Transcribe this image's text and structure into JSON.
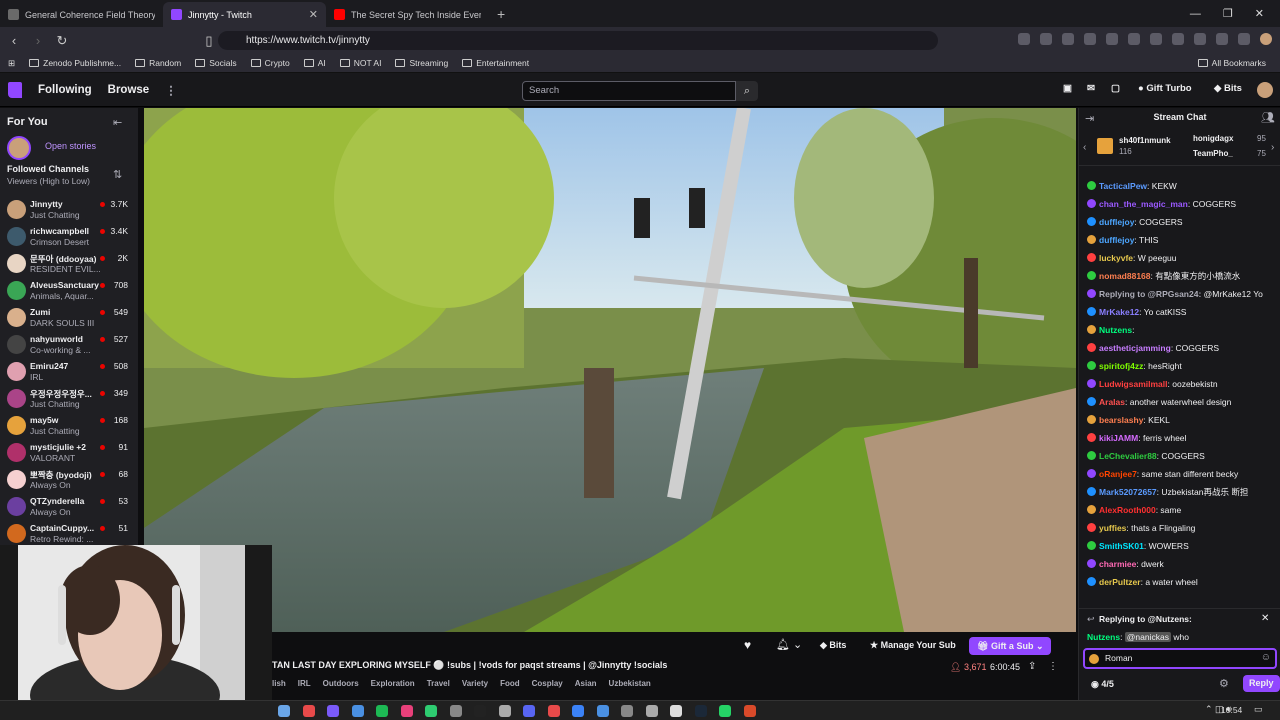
{
  "browser": {
    "tabs": [
      {
        "title": "General Coherence Field Theory (GC",
        "active": false,
        "color": "#6a6a6a"
      },
      {
        "title": "Jinnytty - Twitch",
        "active": true,
        "color": "#9147ff"
      },
      {
        "title": "The Secret Spy Tech Inside Every Cre",
        "active": false,
        "color": "#ff0000"
      }
    ],
    "url": "https://www.twitch.tv/jinnytty",
    "bookmarks": [
      "Zenodo Publishme...",
      "Random",
      "Socials",
      "Crypto",
      "AI",
      "NOT AI",
      "Streaming",
      "Entertainment"
    ],
    "all_bookmarks": "All Bookmarks"
  },
  "twitch_nav": {
    "following": "Following",
    "browse": "Browse",
    "search_placeholder": "Search",
    "gift_turbo": "Gift Turbo",
    "bits": "Bits"
  },
  "sidebar": {
    "for_you": "For You",
    "open_stories": "Open stories",
    "followed_title": "Followed Channels",
    "followed_sort": "Viewers (High to Low)",
    "channels": [
      {
        "name": "Jinnytty",
        "game": "Just Chatting",
        "viewers": "3.7K",
        "color": "#c9a07a"
      },
      {
        "name": "richwcampbell",
        "game": "Crimson Desert",
        "viewers": "3.4K",
        "color": "#3d5a6c"
      },
      {
        "name": "문뚜아 (ddooyaa)",
        "game": "RESIDENT EVIL...",
        "viewers": "2K",
        "color": "#e8d5c4"
      },
      {
        "name": "AlveusSanctuary",
        "game": "Animals, Aquar...",
        "viewers": "708",
        "color": "#3aa655"
      },
      {
        "name": "Zumi",
        "game": "DARK SOULS III",
        "viewers": "549",
        "color": "#d9b08c"
      },
      {
        "name": "nahyunworld",
        "game": "Co-working & ...",
        "viewers": "527",
        "color": "#444"
      },
      {
        "name": "Emiru247",
        "game": "IRL",
        "viewers": "508",
        "color": "#e0a0b0"
      },
      {
        "name": "우정우정우정우...",
        "game": "Just Chatting",
        "viewers": "349",
        "color": "#a48",
        "}": null
      },
      {
        "name": "may5w",
        "game": "Just Chatting",
        "viewers": "168",
        "color": "#e6a23c"
      },
      {
        "name": "mysticjulie +2",
        "game": "VALORANT",
        "viewers": "91",
        "color": "#b0306a"
      },
      {
        "name": "뽀짝충 (byodoji)",
        "game": "Always On",
        "viewers": "68",
        "color": "#f5d0d0"
      },
      {
        "name": "QTZynderella",
        "game": "Always On",
        "viewers": "53",
        "color": "#6b3fa0"
      },
      {
        "name": "CaptainCuppy...",
        "game": "Retro Rewind: ...",
        "viewers": "51",
        "color": "#d2691e"
      }
    ]
  },
  "stream": {
    "title": "TAN LAST DAY EXPLORING MYSELF ⚪ !subs | !vods for paqst streams | @Jinnytty !socials",
    "tags": [
      "lish",
      "IRL",
      "Outdoors",
      "Exploration",
      "Travel",
      "Variety",
      "Food",
      "Cosplay",
      "Asian",
      "Uzbekistan"
    ],
    "viewers": "3,671",
    "uptime": "6:00:45",
    "bits_label": "Bits",
    "manage_sub": "Manage Your Sub",
    "gift_sub": "Gift a Sub"
  },
  "chat": {
    "title": "Stream Chat",
    "top_gifters": [
      {
        "name": "sh40f1nmunk",
        "count": "116"
      },
      {
        "name": "honigdagx",
        "count": "95"
      },
      {
        "name": "TeamPho_",
        "count": "75"
      }
    ],
    "messages": [
      {
        "user": "TacticalPew",
        "color": "#5b9bff",
        "text": "KEKW"
      },
      {
        "user": "chan_the_magic_man",
        "color": "#9b59ff",
        "text": "COGGERS"
      },
      {
        "user": "dufflejoy",
        "color": "#4da6ff",
        "text": "COGGERS"
      },
      {
        "user": "dufflejoy",
        "color": "#4da6ff",
        "text": "THIS"
      },
      {
        "user": "luckyvfe",
        "color": "#e6c84d",
        "text": "W peeguu"
      },
      {
        "user": "nomad88168",
        "color": "#ff7f50",
        "text": "有點像東方的小橋流水"
      },
      {
        "user": "Replying to @RPGsan24:",
        "color": "#adadb8",
        "text": "@MrKake12 Yo"
      },
      {
        "user": "MrKake12",
        "color": "#8a7fff",
        "text": "Yo catKISS"
      },
      {
        "user": "Nutzens",
        "color": "#00ff7f",
        "text": ""
      },
      {
        "user": "aestheticjamming",
        "color": "#c77dff",
        "text": "COGGERS"
      },
      {
        "user": "spiritofj4zz",
        "color": "#7fff00",
        "text": "hesRight"
      },
      {
        "user": "Ludwigsamilmall",
        "color": "#ff4040",
        "text": "oozebekistn"
      },
      {
        "user": "Aralas",
        "color": "#ff5050",
        "text": "another waterwheel design"
      },
      {
        "user": "bearslashy",
        "color": "#ff7f50",
        "text": "KEKL"
      },
      {
        "user": "kikiJAMM",
        "color": "#d66bff",
        "text": "ferris wheel"
      },
      {
        "user": "LeChevalier88",
        "color": "#2ecc40",
        "text": "COGGERS"
      },
      {
        "user": "oRanjee7",
        "color": "#ff4500",
        "text": "same stan different becky"
      },
      {
        "user": "Mark52072657",
        "color": "#5b9bff",
        "text": "Uzbekistan再战乐 断担"
      },
      {
        "user": "AlexRooth000",
        "color": "#ff3030",
        "text": "same"
      },
      {
        "user": "yuffies",
        "color": "#e6c84d",
        "text": "thats a Flingaling"
      },
      {
        "user": "SmithSK01",
        "color": "#00e6ff",
        "text": "WOWERS"
      },
      {
        "user": "charmiee",
        "color": "#ff69b4",
        "text": "dwerk"
      },
      {
        "user": "derPultzer",
        "color": "#e6c84d",
        "text": "a water wheel"
      }
    ],
    "reply_to": "Replying to @Nutzens:",
    "reply_user": "Nutzens",
    "reply_mention": "@nanickas",
    "reply_text": "who",
    "input_value": "Roman",
    "counter": "4/5",
    "reply_button": "Reply"
  },
  "taskbar": {
    "time": "10:54"
  }
}
